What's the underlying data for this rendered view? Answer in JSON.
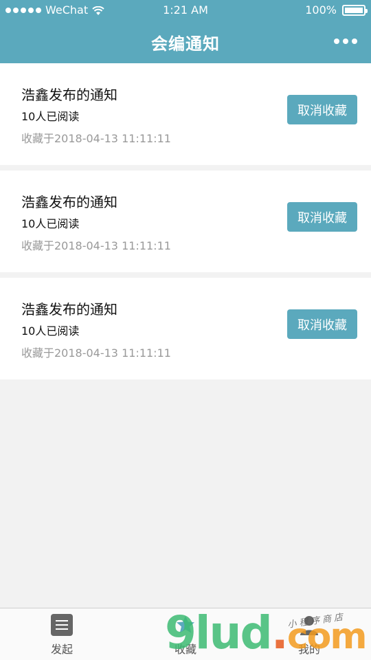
{
  "status_bar": {
    "carrier": "WeChat",
    "time": "1:21 AM",
    "battery": "100%"
  },
  "nav": {
    "title": "会编通知"
  },
  "notices": [
    {
      "title": "浩鑫发布的通知",
      "read_count": "10人已阅读",
      "saved_at": "收藏于2018-04-13 11:11:11",
      "action_label": "取消收藏"
    },
    {
      "title": "浩鑫发布的通知",
      "read_count": "10人已阅读",
      "saved_at": "收藏于2018-04-13 11:11:11",
      "action_label": "取消收藏"
    },
    {
      "title": "浩鑫发布的通知",
      "read_count": "10人已阅读",
      "saved_at": "收藏于2018-04-13 11:11:11",
      "action_label": "取消收藏"
    }
  ],
  "tabbar": {
    "items": [
      {
        "label": "发起",
        "icon": "list-icon"
      },
      {
        "label": "收藏",
        "icon": "star-icon"
      },
      {
        "label": "我的",
        "icon": "person-icon"
      }
    ]
  },
  "watermark": {
    "text": "9lud.com",
    "subtext": "小程序商店"
  },
  "colors": {
    "accent": "#5ba9bd",
    "background": "#f2f2f2"
  }
}
